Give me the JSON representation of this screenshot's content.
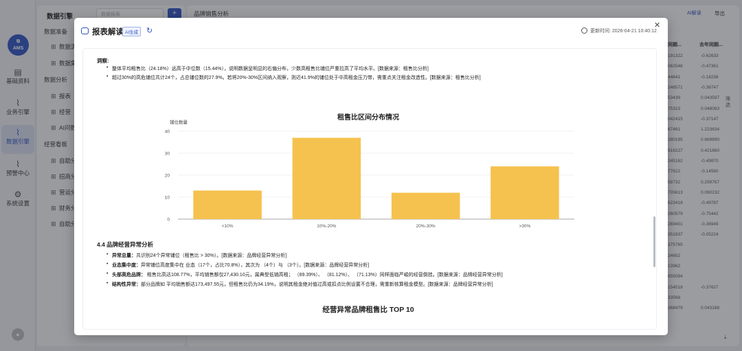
{
  "app": {
    "logo_text": "AMS",
    "nav": [
      {
        "label": "基础资料",
        "icon": "document-icon"
      },
      {
        "label": "业务引擎",
        "icon": "line-chart-icon"
      },
      {
        "label": "数据引擎",
        "icon": "line-chart-icon"
      },
      {
        "label": "预警中心",
        "icon": "line-chart-icon"
      },
      {
        "label": "系统设置",
        "icon": "gear-icon"
      }
    ],
    "tree": {
      "title": "数据引擎",
      "search_placeholder": "数据报表",
      "groups": [
        {
          "label": "数据准备",
          "items": [
            "数据源",
            "数据集"
          ]
        },
        {
          "label": "数据分析",
          "items": [
            "报表",
            "经营",
            "AI问数"
          ]
        },
        {
          "label": "经营看板",
          "items": [
            "自助分",
            "招商分",
            "营运分",
            "财务分",
            "自助分"
          ]
        }
      ]
    },
    "main_title": "品牌销售分析",
    "ai_button": "AI解读",
    "export_label": "导出",
    "table_headers": [
      "同期...",
      "去年同期..."
    ],
    "table_col1": [
      "191322",
      "062548",
      "44641",
      "248571",
      "53439",
      "75323",
      "042415",
      "67461",
      "280185",
      "916227",
      "245162",
      "77622",
      "58732",
      "705613",
      "623418",
      "260579",
      "269401",
      "351837",
      "375765",
      "24652",
      "13962",
      "855094",
      "154518",
      "33568",
      "368479"
    ],
    "table_col2": [
      "-0.62633",
      "-0.47361",
      "-0.18236",
      "-0.36747",
      "0.043597",
      "0.048083",
      "-0.37147",
      "1.223634",
      "0.669890",
      "0.421860",
      "-0.49870",
      "-0.14560",
      "0.299767",
      "0.090232",
      "-0.49787",
      "-0.75442",
      "-0.36949",
      "-0.05224",
      "",
      "",
      "",
      "",
      "-0.37627",
      "",
      "0.043168"
    ],
    "filter_label": "筛选",
    "download_icon": "download-icon"
  },
  "modal": {
    "title": "报表解读",
    "badge": "AI生成",
    "updated_label": "更新时间:",
    "updated_time": "2026-04-21 10:40:12",
    "observation_label": "洞察:",
    "observations": [
      "整体平均租售比（24.18%）远高于中位数（15.44%），说明数据呈明显的右偏分布，少数高租售比铺位严重拉高了平均水平。[数据来源：租售比分析]",
      "超过30%的高危铺位共计24个，占总铺位数的27.9%。若将20%-30%区间纳入观察，则近41.9%的铺位处于中高租金压力带，需重点关注租金改造性。[数据来源：租售比分析]"
    ],
    "section_heading": "4.4 品牌经营异常分析",
    "anomalies": [
      {
        "title": "异常总量：",
        "text": "共识别24个异常铺位（租售比 > 30%）。[数据来源：品牌经营异常分析]"
      },
      {
        "title": "业态集中度：",
        "text": "异常铺位高度集中在        业态（17个，占比70.8%），其次为        （4个）与        （3个）。[数据来源：品牌经营异常分析]"
      },
      {
        "title": "头部高危品牌：",
        "text": "        租售比高达108.77%，平均销售额仅27,430.10元，属典型低销高租；        （89.39%）、        （81.12%）、        （71.13%）同样面临严峻的经营倒挂。[数据来源：品牌经营异常分析]"
      },
      {
        "title": "结构性异常：",
        "text": "部分品牌如        平均销售额达173,497.55元，但租售比仍为34.19%，说明其租金绝对值过高或扣点比例设置不合理，需重新核算租金模型。[数据来源：品牌经营异常分析]"
      }
    ],
    "chart2_title": "经营异常品牌租售比 TOP 10"
  },
  "chart_data": {
    "type": "bar",
    "title": "租售比区间分布情况",
    "ylabel": "铺位数量",
    "xlabel": "",
    "categories": [
      "<10%",
      "10%-20%",
      "20%-30%",
      ">30%"
    ],
    "values": [
      13,
      37,
      12,
      24
    ],
    "ylim": [
      0,
      40
    ],
    "yticks": [
      0,
      10,
      20,
      30,
      40
    ],
    "grid": true,
    "bar_color": "#f5c24f",
    "legend": "none"
  }
}
